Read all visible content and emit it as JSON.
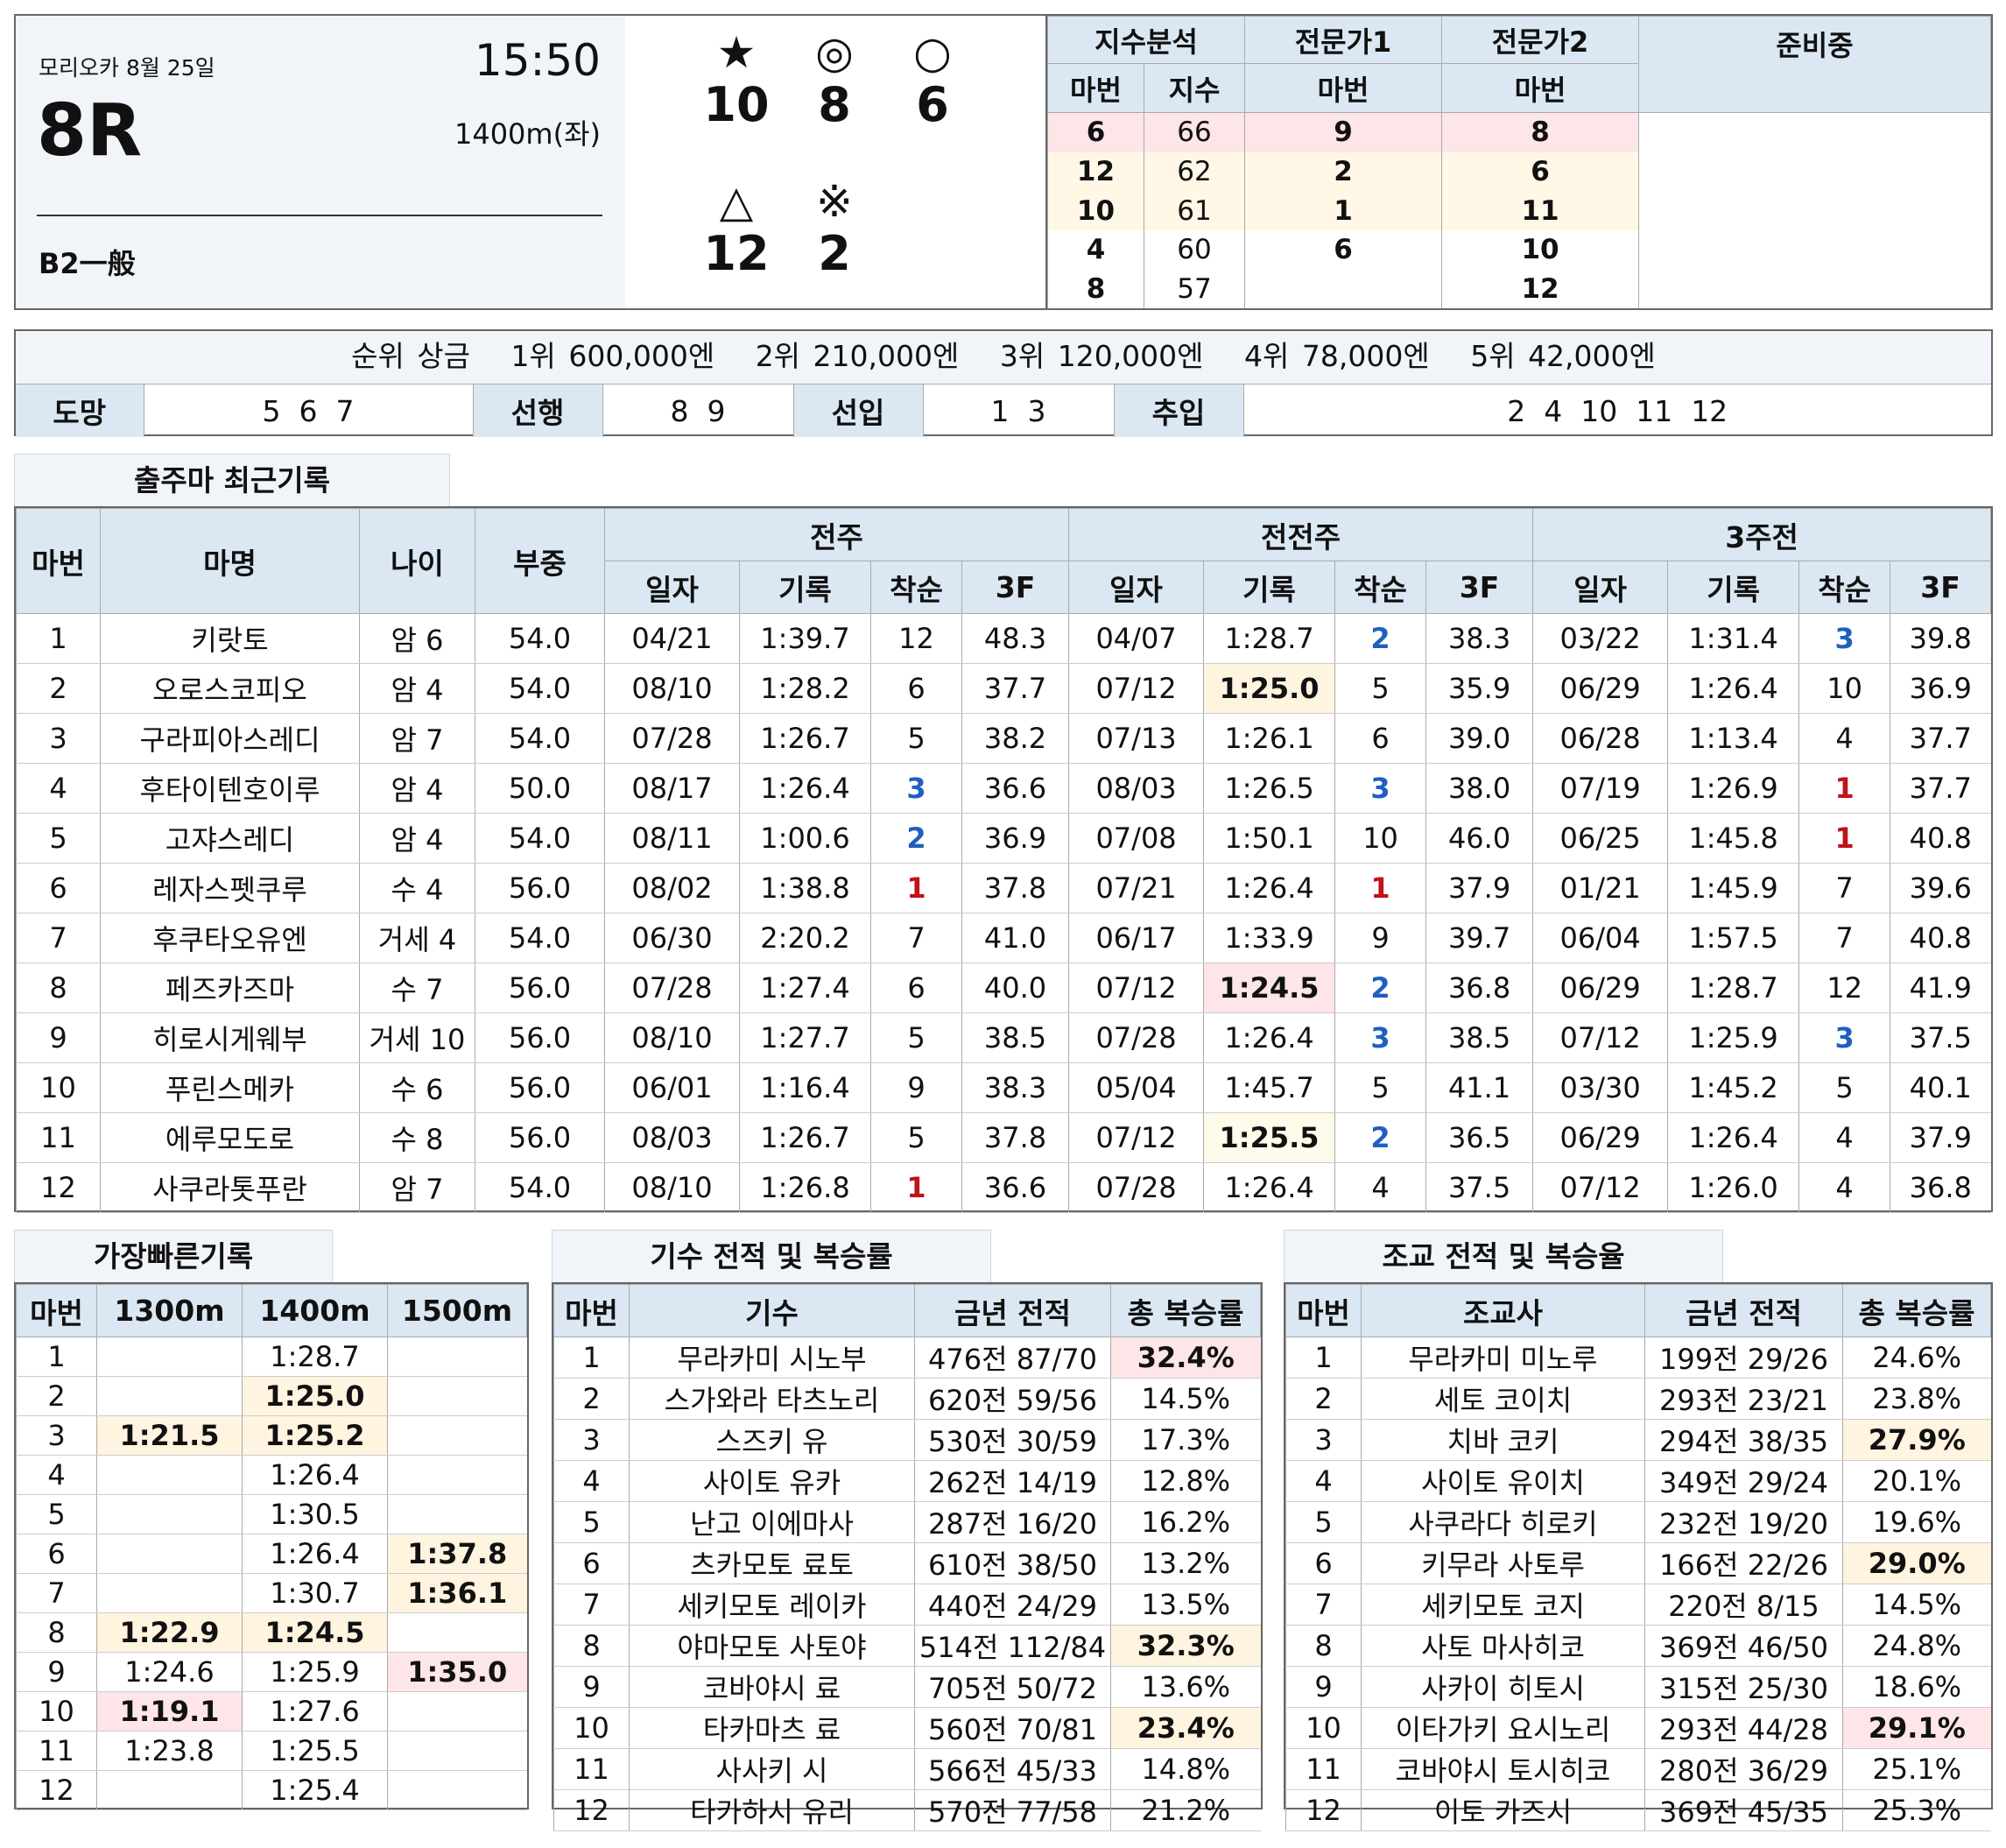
{
  "header": {
    "location_date": "모리오카 8월 25일",
    "time": "15:50",
    "race": "8R",
    "distance": "1400m(좌)",
    "class": "B2一般"
  },
  "marks": [
    {
      "symbol": "★",
      "num": "10"
    },
    {
      "symbol": "◎",
      "num": "8"
    },
    {
      "symbol": "○",
      "num": "6"
    },
    {
      "symbol": "△",
      "num": "12"
    },
    {
      "symbol": "※",
      "num": "2"
    }
  ],
  "index_analysis": {
    "title": "지수분석",
    "col_horse": "마번",
    "col_index": "지수",
    "rows": [
      {
        "horse": "6",
        "index": "66"
      },
      {
        "horse": "12",
        "index": "62"
      },
      {
        "horse": "10",
        "index": "61"
      },
      {
        "horse": "4",
        "index": "60"
      },
      {
        "horse": "8",
        "index": "57"
      }
    ]
  },
  "expert1": {
    "title": "전문가1",
    "col": "마번",
    "picks": [
      "9",
      "2",
      "1",
      "6",
      ""
    ]
  },
  "expert2": {
    "title": "전문가2",
    "col": "마번",
    "picks": [
      "8",
      "6",
      "11",
      "10",
      "12"
    ]
  },
  "preparing": {
    "title": "준비중"
  },
  "prize": {
    "label": "순위 상금",
    "items": [
      "1위 600,000엔",
      "2위 210,000엔",
      "3위 120,000엔",
      "4위 78,000엔",
      "5위 42,000엔"
    ]
  },
  "styles": [
    {
      "label": "도망",
      "horses": "5  6  7"
    },
    {
      "label": "선행",
      "horses": "8  9"
    },
    {
      "label": "선입",
      "horses": "1  3"
    },
    {
      "label": "추입",
      "horses": "2  4  10  11  12"
    }
  ],
  "recent": {
    "tab": "출주마 최근기록",
    "headers": {
      "num": "마번",
      "name": "마명",
      "age": "나이",
      "weight": "부중",
      "g1": "전주",
      "g2": "전전주",
      "g3": "3주전",
      "date": "일자",
      "time": "기록",
      "finish": "착순",
      "f3": "3F"
    },
    "rows": [
      {
        "num": "1",
        "name": "키랏토",
        "age": "암 6",
        "weight": "54.0",
        "r": [
          [
            "04/21",
            "1:39.7",
            "12",
            "48.3"
          ],
          [
            "04/07",
            "1:28.7",
            "2",
            "38.3"
          ],
          [
            "03/22",
            "1:31.4",
            "3",
            "39.8"
          ]
        ]
      },
      {
        "num": "2",
        "name": "오로스코피오",
        "age": "암 4",
        "weight": "54.0",
        "r": [
          [
            "08/10",
            "1:28.2",
            "6",
            "37.7"
          ],
          [
            "07/12",
            "1:25.0",
            "5",
            "35.9"
          ],
          [
            "06/29",
            "1:26.4",
            "10",
            "36.9"
          ]
        ]
      },
      {
        "num": "3",
        "name": "구라피아스레디",
        "age": "암 7",
        "weight": "54.0",
        "r": [
          [
            "07/28",
            "1:26.7",
            "5",
            "38.2"
          ],
          [
            "07/13",
            "1:26.1",
            "6",
            "39.0"
          ],
          [
            "06/28",
            "1:13.4",
            "4",
            "37.7"
          ]
        ]
      },
      {
        "num": "4",
        "name": "후타이텐호이루",
        "age": "암 4",
        "weight": "50.0",
        "r": [
          [
            "08/17",
            "1:26.4",
            "3",
            "36.6"
          ],
          [
            "08/03",
            "1:26.5",
            "3",
            "38.0"
          ],
          [
            "07/19",
            "1:26.9",
            "1",
            "37.7"
          ]
        ]
      },
      {
        "num": "5",
        "name": "고쟈스레디",
        "age": "암 4",
        "weight": "54.0",
        "r": [
          [
            "08/11",
            "1:00.6",
            "2",
            "36.9"
          ],
          [
            "07/08",
            "1:50.1",
            "10",
            "46.0"
          ],
          [
            "06/25",
            "1:45.8",
            "1",
            "40.8"
          ]
        ]
      },
      {
        "num": "6",
        "name": "레자스펫쿠루",
        "age": "수 4",
        "weight": "56.0",
        "r": [
          [
            "08/02",
            "1:38.8",
            "1",
            "37.8"
          ],
          [
            "07/21",
            "1:26.4",
            "1",
            "37.9"
          ],
          [
            "01/21",
            "1:45.9",
            "7",
            "39.6"
          ]
        ]
      },
      {
        "num": "7",
        "name": "후쿠타오유엔",
        "age": "거세 4",
        "weight": "54.0",
        "r": [
          [
            "06/30",
            "2:20.2",
            "7",
            "41.0"
          ],
          [
            "06/17",
            "1:33.9",
            "9",
            "39.7"
          ],
          [
            "06/04",
            "1:57.5",
            "7",
            "40.8"
          ]
        ]
      },
      {
        "num": "8",
        "name": "페즈카즈마",
        "age": "수 7",
        "weight": "56.0",
        "r": [
          [
            "07/28",
            "1:27.4",
            "6",
            "40.0"
          ],
          [
            "07/12",
            "1:24.5",
            "2",
            "36.8"
          ],
          [
            "06/29",
            "1:28.7",
            "12",
            "41.9"
          ]
        ]
      },
      {
        "num": "9",
        "name": "히로시게웨부",
        "age": "거세 10",
        "weight": "56.0",
        "r": [
          [
            "08/10",
            "1:27.7",
            "5",
            "38.5"
          ],
          [
            "07/28",
            "1:26.4",
            "3",
            "38.5"
          ],
          [
            "07/12",
            "1:25.9",
            "3",
            "37.5"
          ]
        ]
      },
      {
        "num": "10",
        "name": "푸린스메카",
        "age": "수 6",
        "weight": "56.0",
        "r": [
          [
            "06/01",
            "1:16.4",
            "9",
            "38.3"
          ],
          [
            "05/04",
            "1:45.7",
            "5",
            "41.1"
          ],
          [
            "03/30",
            "1:45.2",
            "5",
            "40.1"
          ]
        ]
      },
      {
        "num": "11",
        "name": "에루모도로",
        "age": "수 8",
        "weight": "56.0",
        "r": [
          [
            "08/03",
            "1:26.7",
            "5",
            "37.8"
          ],
          [
            "07/12",
            "1:25.5",
            "2",
            "36.5"
          ],
          [
            "06/29",
            "1:26.4",
            "4",
            "37.9"
          ]
        ]
      },
      {
        "num": "12",
        "name": "사쿠라톳푸란",
        "age": "암 7",
        "weight": "54.0",
        "r": [
          [
            "08/10",
            "1:26.8",
            "1",
            "36.6"
          ],
          [
            "07/28",
            "1:26.4",
            "4",
            "37.5"
          ],
          [
            "07/12",
            "1:26.0",
            "4",
            "36.8"
          ]
        ]
      }
    ]
  },
  "fastest": {
    "tab": "가장빠른기록",
    "headers": [
      "마번",
      "1300m",
      "1400m",
      "1500m"
    ],
    "rows": [
      [
        "1",
        "",
        "1:28.7",
        ""
      ],
      [
        "2",
        "",
        "1:25.0",
        ""
      ],
      [
        "3",
        "1:21.5",
        "1:25.2",
        ""
      ],
      [
        "4",
        "",
        "1:26.4",
        ""
      ],
      [
        "5",
        "",
        "1:30.5",
        ""
      ],
      [
        "6",
        "",
        "1:26.4",
        "1:37.8"
      ],
      [
        "7",
        "",
        "1:30.7",
        "1:36.1"
      ],
      [
        "8",
        "1:22.9",
        "1:24.5",
        ""
      ],
      [
        "9",
        "1:24.6",
        "1:25.9",
        "1:35.0"
      ],
      [
        "10",
        "1:19.1",
        "1:27.6",
        ""
      ],
      [
        "11",
        "1:23.8",
        "1:25.5",
        ""
      ],
      [
        "12",
        "",
        "1:25.4",
        ""
      ]
    ]
  },
  "jockey": {
    "tab": "기수 전적 및 복승률",
    "headers": [
      "마번",
      "기수",
      "금년 전적",
      "총 복승률"
    ],
    "rows": [
      [
        "1",
        "무라카미 시노부",
        "476전 87/70",
        "32.4%"
      ],
      [
        "2",
        "스가와라 타츠노리",
        "620전 59/56",
        "14.5%"
      ],
      [
        "3",
        "스즈키 유",
        "530전 30/59",
        "17.3%"
      ],
      [
        "4",
        "사이토 유카",
        "262전 14/19",
        "12.8%"
      ],
      [
        "5",
        "난고 이에마사",
        "287전 16/20",
        "16.2%"
      ],
      [
        "6",
        "츠카모토 료토",
        "610전 38/50",
        "13.2%"
      ],
      [
        "7",
        "세키모토 레이카",
        "440전 24/29",
        "13.5%"
      ],
      [
        "8",
        "야마모토 사토야",
        "514전 112/84",
        "32.3%"
      ],
      [
        "9",
        "코바야시 료",
        "705전 50/72",
        "13.6%"
      ],
      [
        "10",
        "타카마츠 료",
        "560전 70/81",
        "23.4%"
      ],
      [
        "11",
        "사사키 시",
        "566전 45/33",
        "14.8%"
      ],
      [
        "12",
        "타카하시 유리",
        "570전 77/58",
        "21.2%"
      ]
    ]
  },
  "trainer": {
    "tab": "조교 전적 및 복승율",
    "headers": [
      "마번",
      "조교사",
      "금년 전적",
      "총 복승률"
    ],
    "rows": [
      [
        "1",
        "무라카미 미노루",
        "199전 29/26",
        "24.6%"
      ],
      [
        "2",
        "세토 코이치",
        "293전 23/21",
        "23.8%"
      ],
      [
        "3",
        "치바 코키",
        "294전 38/35",
        "27.9%"
      ],
      [
        "4",
        "사이토 유이치",
        "349전 29/24",
        "20.1%"
      ],
      [
        "5",
        "사쿠라다 히로키",
        "232전 19/20",
        "19.6%"
      ],
      [
        "6",
        "키무라 사토루",
        "166전 22/26",
        "29.0%"
      ],
      [
        "7",
        "세키모토 코지",
        "220전 8/15",
        "14.5%"
      ],
      [
        "8",
        "사토 마사히코",
        "369전 46/50",
        "24.8%"
      ],
      [
        "9",
        "사카이 히토시",
        "315전 25/30",
        "18.6%"
      ],
      [
        "10",
        "이타가키 요시노리",
        "293전 44/28",
        "29.1%"
      ],
      [
        "11",
        "코바야시 토시히코",
        "280전 36/29",
        "25.1%"
      ],
      [
        "12",
        "이토 카즈시",
        "369전 45/35",
        "25.3%"
      ]
    ]
  }
}
